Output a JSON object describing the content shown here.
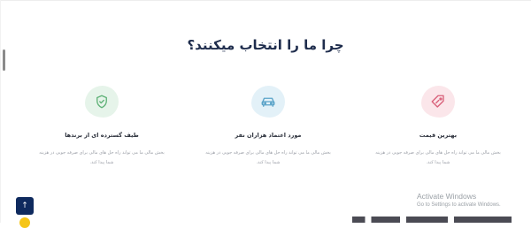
{
  "section": {
    "heading": "چرا ما را انتخاب میکنند؟"
  },
  "features": [
    {
      "title": "طیف گسترده ای از برندها",
      "description": "بخش مالی ما می تواند راه حل های مالی برای صرفه جویی در هزینه شما پیدا کند.",
      "icon": "shield-check-icon",
      "blob_color": "#e6f4ea",
      "icon_color": "#5fb277"
    },
    {
      "title": "مورد اعتماد هزاران نفر",
      "description": "بخش مالی ما می تواند راه حل های مالی برای صرفه جویی در هزینه شما پیدا کند.",
      "icon": "car-icon",
      "blob_color": "#e3f1f8",
      "icon_color": "#5aa3c8"
    },
    {
      "title": "بهترین قیمت",
      "description": "بخش مالی ما می تواند راه حل های مالی برای صرفه جویی در هزینه شما پیدا کند.",
      "icon": "price-tag-icon",
      "blob_color": "#fbe6ea",
      "icon_color": "#d9607a"
    }
  ],
  "scroll_top_button": {
    "icon": "arrow-up-icon",
    "glyph": "↑",
    "color": "#0f2a5e"
  },
  "watermark": {
    "title": "Activate Windows",
    "subtitle": "Go to Settings to activate Windows."
  }
}
